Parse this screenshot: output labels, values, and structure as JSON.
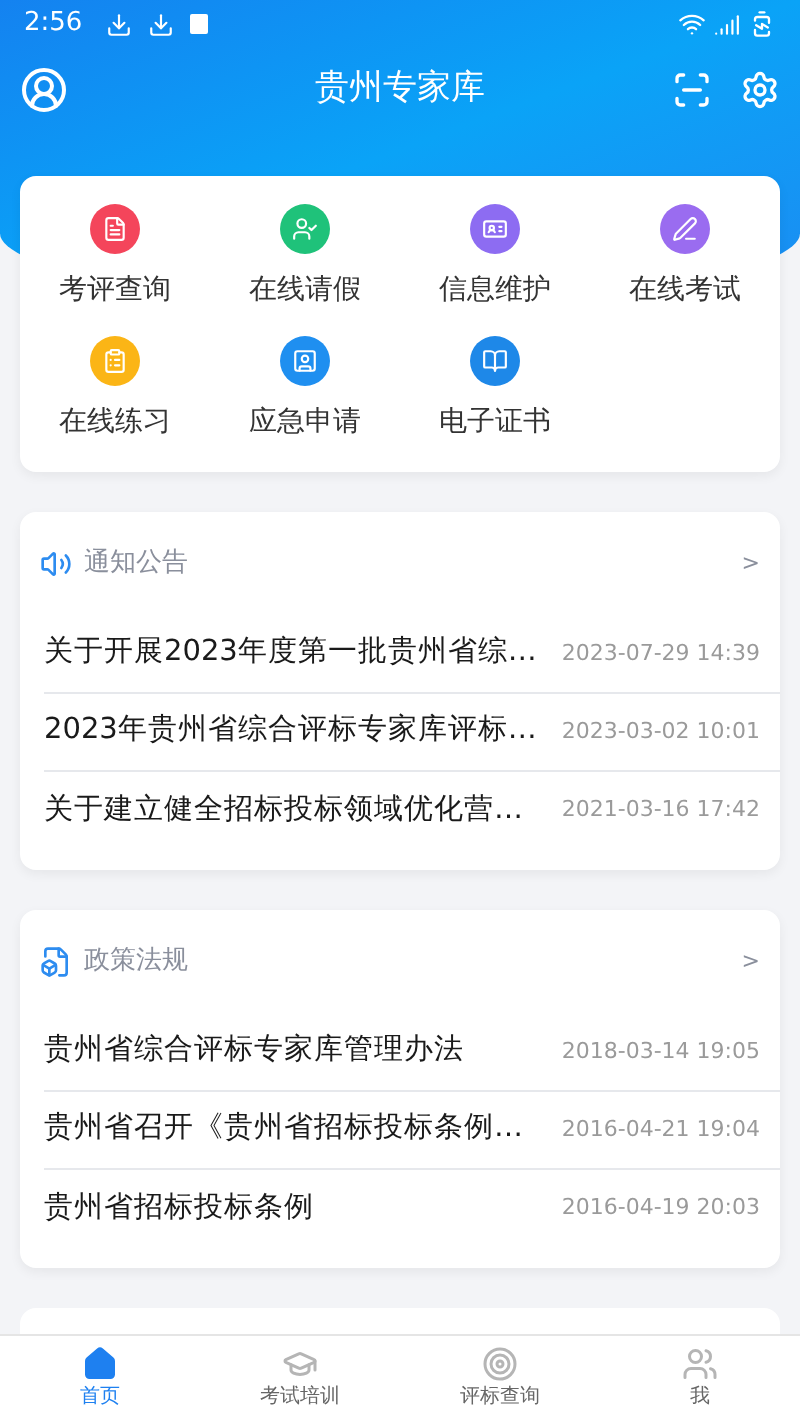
{
  "status_bar": {
    "time": "2:56"
  },
  "header": {
    "title": "贵州专家库"
  },
  "apps": [
    {
      "label": "考评查询",
      "color": "#f4455b",
      "kind": "form"
    },
    {
      "label": "在线请假",
      "color": "#1fc27a",
      "kind": "person"
    },
    {
      "label": "信息维护",
      "color": "#8d6cf2",
      "kind": "card"
    },
    {
      "label": "在线考试",
      "color": "#9a6cf0",
      "kind": "pen"
    },
    {
      "label": "在线练习",
      "color": "#fbb516",
      "kind": "list"
    },
    {
      "label": "应急申请",
      "color": "#1f8ff0",
      "kind": "user"
    },
    {
      "label": "电子证书",
      "color": "#1e88e8",
      "kind": "book"
    }
  ],
  "sections": [
    {
      "kind": "notice",
      "title": "通知公告",
      "more": ">",
      "items": [
        {
          "title": "关于开展2023年度第一批贵州省综…",
          "date": "2023-07-29 14:39"
        },
        {
          "title": "2023年贵州省综合评标专家库评标…",
          "date": "2023-03-02 10:01"
        },
        {
          "title": "关于建立健全招标投标领域优化营…",
          "date": "2021-03-16 17:42"
        }
      ]
    },
    {
      "kind": "policy",
      "title": "政策法规",
      "more": ">",
      "items": [
        {
          "title": "贵州省综合评标专家库管理办法",
          "date": "2018-03-14 19:05"
        },
        {
          "title": "贵州省召开《贵州省招标投标条例…",
          "date": "2016-04-21 19:04"
        },
        {
          "title": "贵州省招标投标条例",
          "date": "2016-04-19 20:03"
        }
      ]
    }
  ],
  "tabs": [
    {
      "label": "首页",
      "selected": true,
      "kind": "home"
    },
    {
      "label": "考试培训",
      "selected": false,
      "kind": "cap"
    },
    {
      "label": "评标查询",
      "selected": false,
      "kind": "target"
    },
    {
      "label": "我",
      "selected": false,
      "kind": "people"
    }
  ]
}
